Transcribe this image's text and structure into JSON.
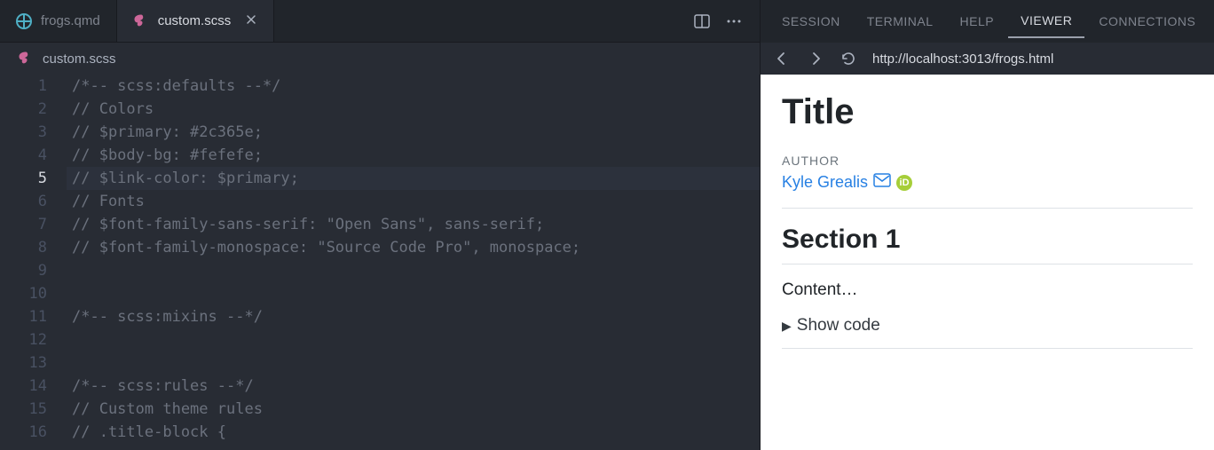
{
  "tabs": {
    "inactive": {
      "label": "frogs.qmd"
    },
    "active": {
      "label": "custom.scss"
    }
  },
  "breadcrumb": {
    "file": "custom.scss"
  },
  "editor": {
    "active_line": 5,
    "lines": [
      "/*-- scss:defaults --*/",
      "// Colors",
      "// $primary: #2c365e;",
      "// $body-bg: #fefefe;",
      "// $link-color: $primary;",
      "// Fonts",
      "// $font-family-sans-serif: \"Open Sans\", sans-serif;",
      "// $font-family-monospace: \"Source Code Pro\", monospace;",
      "",
      "",
      "/*-- scss:mixins --*/",
      "",
      "",
      "/*-- scss:rules --*/",
      "// Custom theme rules",
      "// .title-block {"
    ]
  },
  "viewer": {
    "tabs": [
      "SESSION",
      "TERMINAL",
      "HELP",
      "VIEWER",
      "CONNECTIONS"
    ],
    "active_tab": "VIEWER",
    "url": "http://localhost:3013/frogs.html",
    "doc": {
      "title": "Title",
      "author_label": "AUTHOR",
      "author_name": "Kyle Grealis",
      "section_heading": "Section 1",
      "content_text": "Content…",
      "show_code": "Show code"
    }
  }
}
